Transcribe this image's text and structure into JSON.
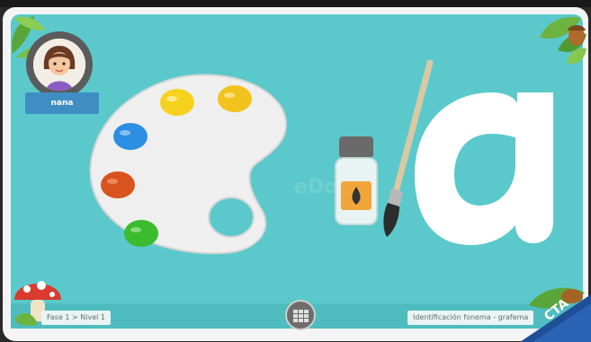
{
  "user": {
    "name": "nana"
  },
  "status": {
    "level_path": "Fase 1 > Nivel 1",
    "activity": "Identificación fonema - grafema"
  },
  "badge": {
    "label": "CTA"
  },
  "watermark": {
    "text": "eDo"
  },
  "letter": {
    "glyph": "a"
  },
  "colors": {
    "stage": "#5bc9cb",
    "palette": "#efefef",
    "paint_yellow": "#f6d21f",
    "paint_blue": "#2d8fe3",
    "paint_red": "#d9531e",
    "paint_green": "#3bbb2e",
    "name_tag": "#3e8ec4",
    "badge_bg": "#1f4f96"
  },
  "icons": {
    "avatar": "girl-avatar-icon",
    "grid": "grid-icon",
    "brush": "paintbrush-icon",
    "bottle": "ink-bottle-icon",
    "palette": "paint-palette-icon",
    "mushroom": "mushroom-icon",
    "leaves": "leaf-icon",
    "acorn": "acorn-icon"
  }
}
